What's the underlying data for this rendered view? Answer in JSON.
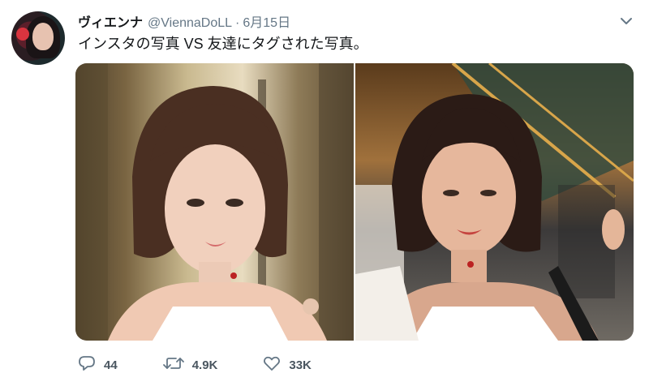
{
  "tweet": {
    "display_name": "ヴィエンナ",
    "handle": "@ViennaDoLL",
    "separator": "·",
    "date": "6月15日",
    "text": "インスタの写真 VS 友達にタグされた写真。",
    "media": [
      {
        "alt": "photo-left"
      },
      {
        "alt": "photo-right"
      }
    ]
  },
  "actions": {
    "replies": "44",
    "retweets": "4.9K",
    "likes": "33K"
  },
  "icons": {
    "reply": "reply-icon",
    "retweet": "retweet-icon",
    "like": "heart-icon",
    "caret": "chevron-down-icon"
  },
  "colors": {
    "text": "#14171a",
    "muted": "#657786"
  }
}
